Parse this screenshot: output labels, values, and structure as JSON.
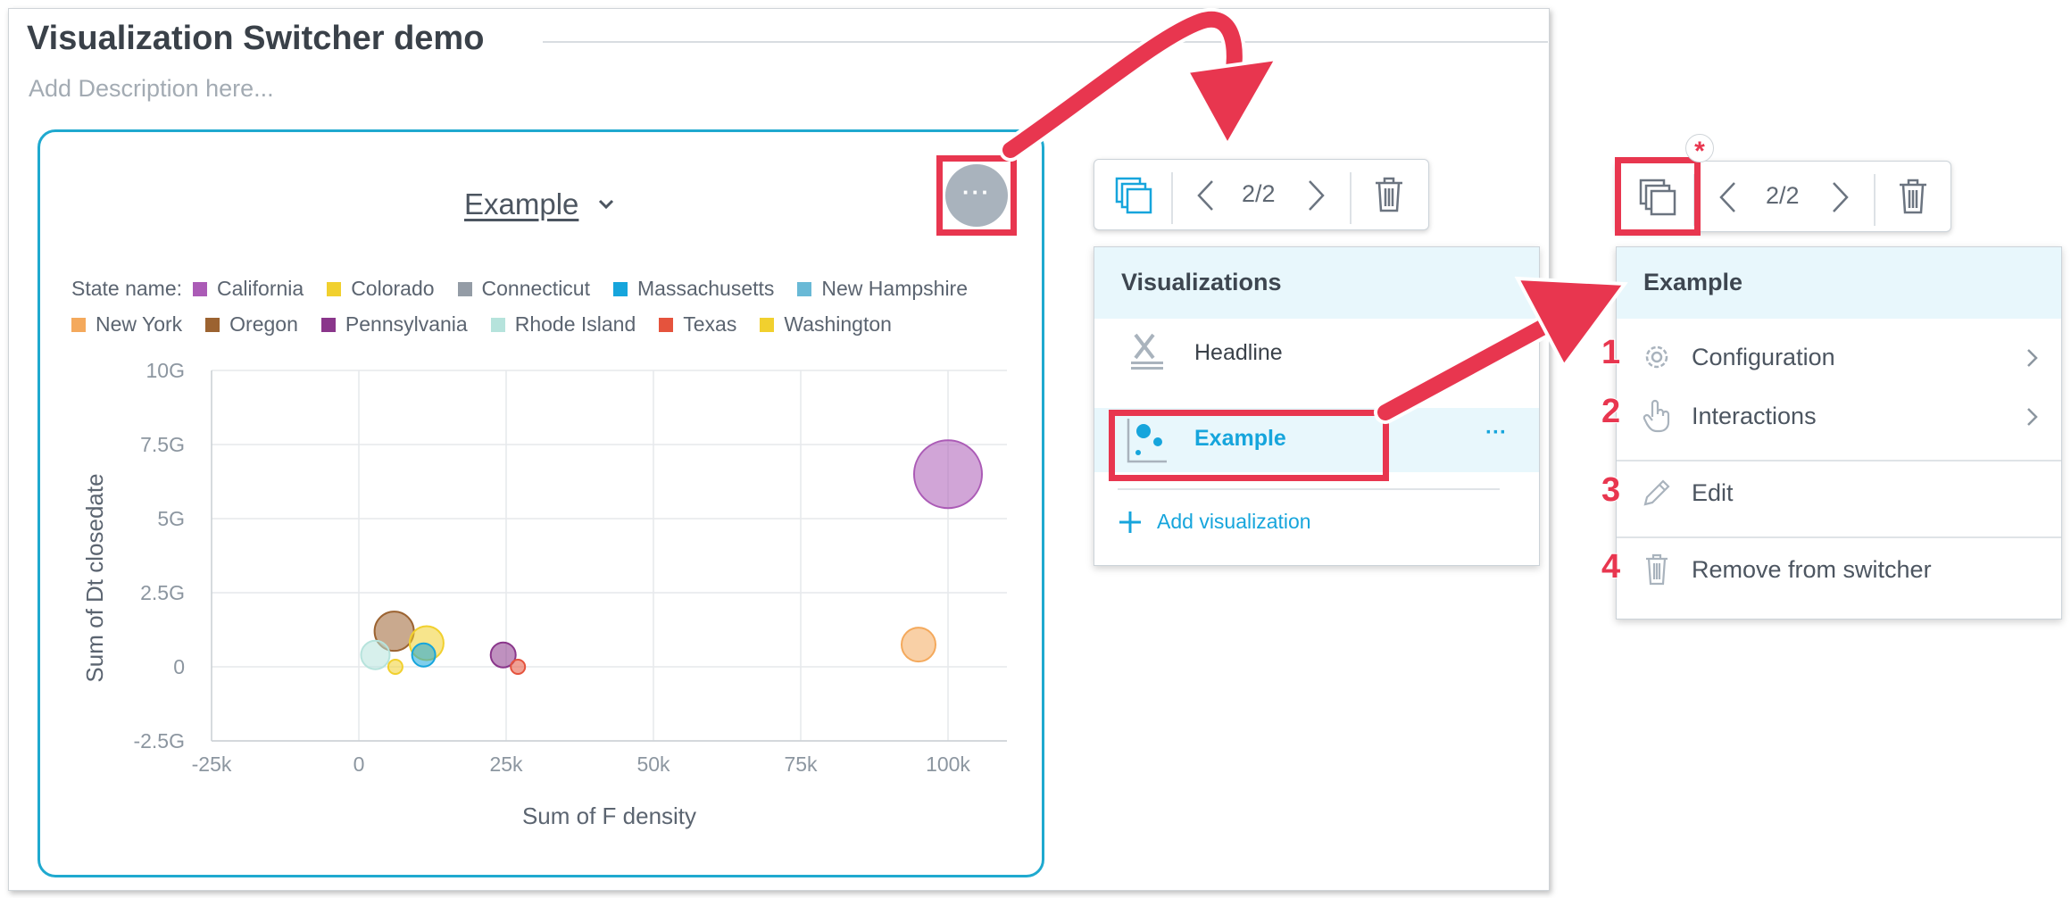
{
  "dashboard": {
    "title": "Visualization Switcher demo",
    "description_placeholder": "Add Description here..."
  },
  "widget": {
    "title": "Example",
    "more_button": "···"
  },
  "legend": {
    "label": "State name:",
    "items": [
      {
        "name": "California",
        "color": "#ab5bb6"
      },
      {
        "name": "Colorado",
        "color": "#f1d02e"
      },
      {
        "name": "Connecticut",
        "color": "#949ca6"
      },
      {
        "name": "Massachusetts",
        "color": "#16a5dc"
      },
      {
        "name": "New Hampshire",
        "color": "#69b9d6"
      },
      {
        "name": "New York",
        "color": "#f4a95c"
      },
      {
        "name": "Oregon",
        "color": "#9c6331"
      },
      {
        "name": "Pennsylvania",
        "color": "#8a368b"
      },
      {
        "name": "Rhode Island",
        "color": "#b6e3dc"
      },
      {
        "name": "Texas",
        "color": "#e5533d"
      },
      {
        "name": "Washington",
        "color": "#f1d02e"
      }
    ]
  },
  "chart_data": {
    "type": "scatter",
    "variant": "bubble",
    "xlabel": "Sum of F density",
    "ylabel": "Sum of Dt closedate",
    "xlim": [
      -25000,
      110000
    ],
    "ylim": [
      -2.5,
      10
    ],
    "x_ticks": [
      -25000,
      0,
      25000,
      50000,
      75000,
      100000
    ],
    "x_tick_labels": [
      "-25k",
      "0",
      "25k",
      "50k",
      "75k",
      "100k"
    ],
    "y_ticks": [
      -2.5,
      0,
      2.5,
      5,
      7.5,
      10
    ],
    "y_tick_labels": [
      "-2.5G",
      "0",
      "2.5G",
      "5G",
      "7.5G",
      "10G"
    ],
    "grid": true,
    "legend_position": "top",
    "points": [
      {
        "series": "California",
        "x": 100000,
        "y": 6.5,
        "r": 38,
        "color": "#ab5bb6"
      },
      {
        "series": "New York",
        "x": 95000,
        "y": 0.75,
        "r": 19,
        "color": "#f4a95c"
      },
      {
        "series": "Oregon",
        "x": 6000,
        "y": 1.2,
        "r": 22,
        "color": "#9c6331"
      },
      {
        "series": "Colorado",
        "x": 11500,
        "y": 0.8,
        "r": 19,
        "color": "#f1d02e"
      },
      {
        "series": "Rhode Island",
        "x": 2800,
        "y": 0.4,
        "r": 16,
        "color": "#b6e3dc"
      },
      {
        "series": "Massachusetts",
        "x": 11000,
        "y": 0.4,
        "r": 13,
        "color": "#16a5dc"
      },
      {
        "series": "Washington",
        "x": 6200,
        "y": 0.0,
        "r": 8,
        "color": "#f1d02e"
      },
      {
        "series": "Pennsylvania",
        "x": 24500,
        "y": 0.4,
        "r": 14,
        "color": "#8a368b"
      },
      {
        "series": "Texas",
        "x": 27000,
        "y": 0.0,
        "r": 8,
        "color": "#e5533d"
      }
    ]
  },
  "toolbar_1": {
    "page": "2/2"
  },
  "visualizations_panel": {
    "header": "Visualizations",
    "items": [
      {
        "label": "Headline"
      },
      {
        "label": "Example",
        "more": "···"
      }
    ],
    "add_label": "Add visualization"
  },
  "toolbar_2": {
    "page": "2/2",
    "badge": "*"
  },
  "context_menu": {
    "header": "Example",
    "items": [
      {
        "num": "1",
        "label": "Configuration"
      },
      {
        "num": "2",
        "label": "Interactions"
      },
      {
        "num": "3",
        "label": "Edit"
      },
      {
        "num": "4",
        "label": "Remove from switcher"
      }
    ]
  },
  "colors": {
    "accent_blue": "#1fa9cf",
    "highlight_red": "#e8364f",
    "panel_header_bg": "#e8f7fc"
  }
}
